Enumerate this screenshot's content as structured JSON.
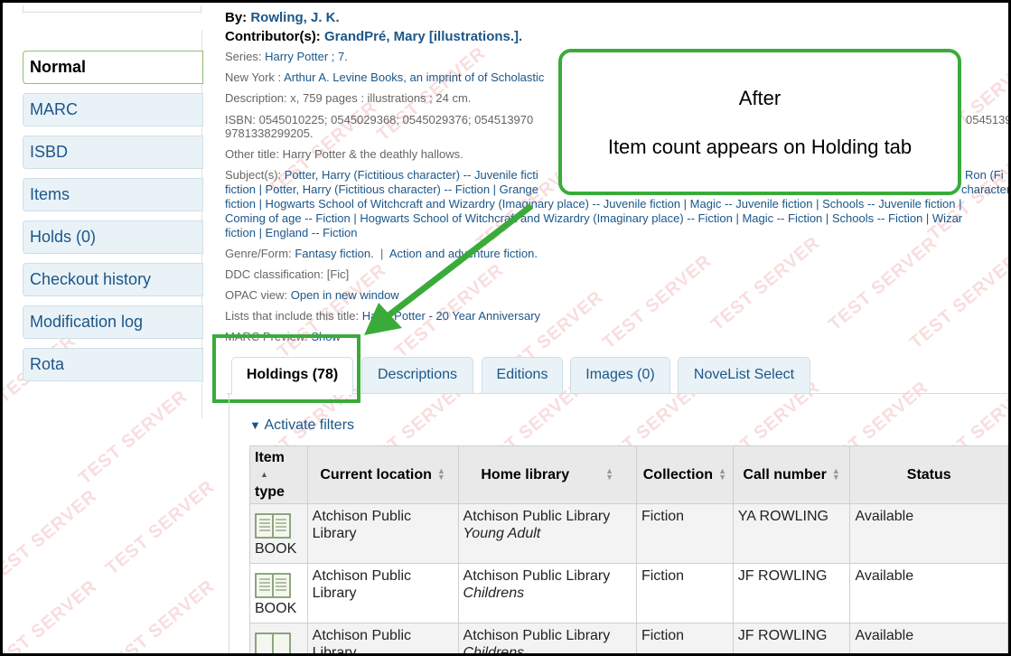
{
  "sidebar": {
    "items": [
      {
        "label": "Normal",
        "active": true
      },
      {
        "label": "MARC"
      },
      {
        "label": "ISBD"
      },
      {
        "label": "Items"
      },
      {
        "label": "Holds (0)"
      },
      {
        "label": "Checkout history"
      },
      {
        "label": "Modification log"
      },
      {
        "label": "Rota"
      }
    ]
  },
  "record": {
    "by_label": "By:",
    "author": "Rowling, J. K.",
    "contrib_label": "Contributor(s):",
    "contributor": "GrandPré, Mary [illustrations.].",
    "series_label": "Series:",
    "series": "Harry Potter ; 7.",
    "publisher_prefix": "New York :",
    "publisher": "Arthur A. Levine Books, an imprint of of Scholastic",
    "description_label": "Description:",
    "description": "x, 759 pages : illustrations ; 24 cm.",
    "isbn_label": "ISBN:",
    "isbn": "0545010225; 0545029368; 0545029376; 054513970",
    "isbn_right": "05451397",
    "isbn_line2": "9781338299205.",
    "other_title_label": "Other title:",
    "other_title": "Harry Potter & the deathly hallows.",
    "subjects_label": "Subject(s):",
    "subjects_line1": "Potter, Harry (Fictitious character) -- Juvenile ficti",
    "subjects_line1_right": "Ron (Fi",
    "subjects_line2": "fiction | Potter, Harry (Fictitious character) -- Fiction | Grange",
    "subjects_line2_right": "character) --",
    "subjects_line3": "fiction | Hogwarts School of Witchcraft and Wizardry (Imaginary place) -- Juvenile fiction | Magic -- Juvenile fiction | Schools -- Juvenile fiction |",
    "subjects_line4": "Coming of age -- Fiction | Hogwarts School of Witchcraft and Wizardry (Imaginary place) -- Fiction | Magic -- Fiction | Schools -- Fiction | Wizar",
    "subjects_line5": "fiction | England -- Fiction",
    "genre_label": "Genre/Form:",
    "genre1": "Fantasy fiction.",
    "genre2": "Action and adventure fiction.",
    "ddc_label": "DDC classification:",
    "ddc": "[Fic]",
    "opac_label": "OPAC view:",
    "opac": "Open in new window",
    "lists_label": "Lists that include this title:",
    "lists": "Harry Potter - 20 Year Anniversary",
    "marc_label": "MARC Preview:",
    "marc": "Show"
  },
  "callout": {
    "title": "After",
    "text": "Item count appears on Holding tab"
  },
  "tabs": [
    {
      "label": "Holdings (78)",
      "active": true
    },
    {
      "label": "Descriptions"
    },
    {
      "label": "Editions"
    },
    {
      "label": "Images (0)"
    },
    {
      "label": "NoveList Select"
    }
  ],
  "filters_label": "Activate filters",
  "table": {
    "headers": [
      "Item type",
      "Current location",
      "Home library",
      "Collection",
      "Call number",
      "Status"
    ],
    "header_item_type_l1": "Item",
    "header_item_type_l2": "type",
    "rows": [
      {
        "type": "BOOK",
        "current_l1": "Atchison Public",
        "current_l2": "Library",
        "home": "Atchison Public Library",
        "home_sub": "Young Adult",
        "collection": "Fiction",
        "call": "YA ROWLING",
        "status": "Available"
      },
      {
        "type": "BOOK",
        "current_l1": "Atchison Public",
        "current_l2": "Library",
        "home": "Atchison Public Library",
        "home_sub": "Childrens",
        "collection": "Fiction",
        "call": "JF ROWLING",
        "status": "Available"
      },
      {
        "type": "",
        "current_l1": "Atchison Public",
        "current_l2": "Library",
        "home": "Atchison Public Library",
        "home_sub": "Childrens",
        "collection": "Fiction",
        "call": "JF ROWLING",
        "status": "Available"
      }
    ]
  },
  "watermark": "TEST SERVER",
  "colors": {
    "link": "#1c5688",
    "highlight": "#3aab3a"
  }
}
